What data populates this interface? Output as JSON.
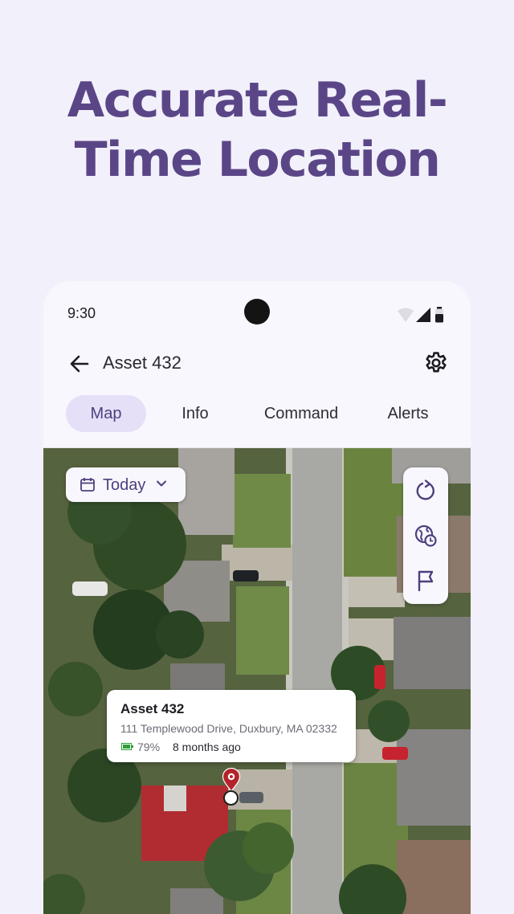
{
  "headline": {
    "line1": "Accurate Real-",
    "line2": "Time Location"
  },
  "status_bar": {
    "time": "9:30"
  },
  "header": {
    "title": "Asset 432",
    "back_icon": "arrow-left-icon",
    "settings_icon": "gear-icon"
  },
  "tabs": [
    {
      "label": "Map",
      "active": true
    },
    {
      "label": "Info",
      "active": false
    },
    {
      "label": "Command",
      "active": false
    },
    {
      "label": "Alerts",
      "active": false
    }
  ],
  "date_filter": {
    "label": "Today",
    "icon": "calendar-icon"
  },
  "map_tools": [
    "refresh-icon",
    "history-globe-icon",
    "flag-icon"
  ],
  "asset_popup": {
    "name": "Asset 432",
    "address": "111 Templewood Drive, Duxbury, MA 02332",
    "battery": "79%",
    "last_seen": "8 months ago"
  },
  "colors": {
    "background": "#f2f0fa",
    "headline": "#5a4687",
    "accent": "#4f3f7e",
    "active_tab": "#e5e0f7",
    "pin": "#b5232a",
    "battery": "#2e9e3a"
  }
}
